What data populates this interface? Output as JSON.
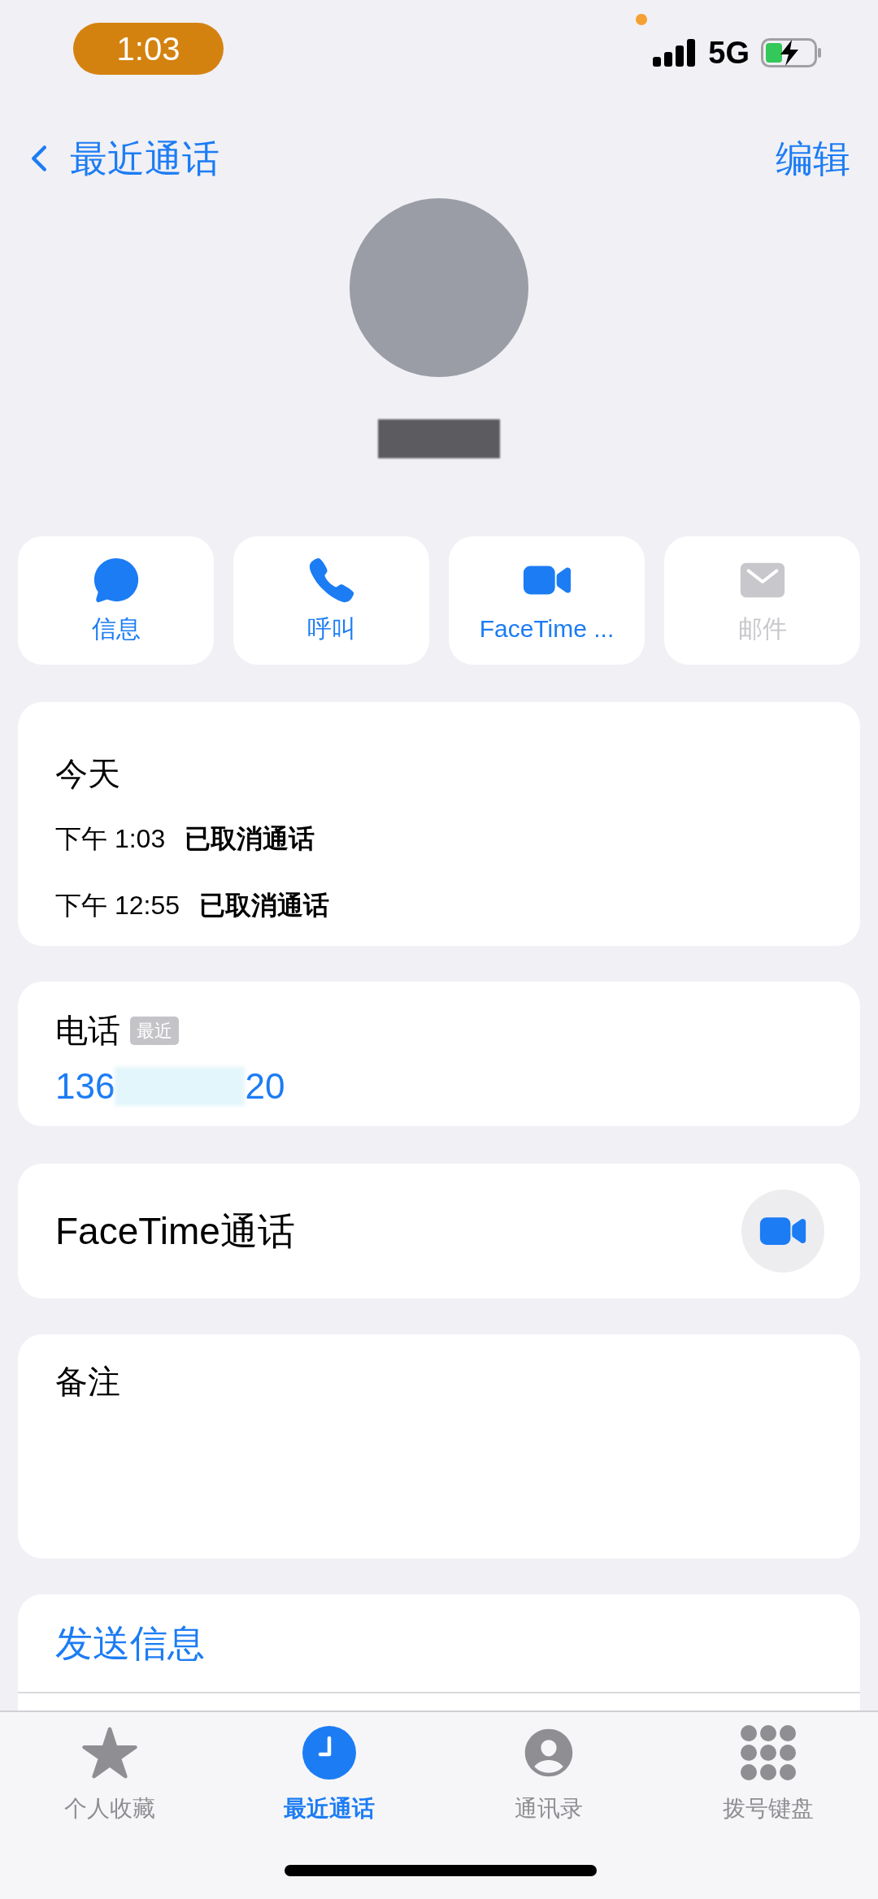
{
  "status_bar": {
    "time": "1:03",
    "network": "5G"
  },
  "nav": {
    "back_label": "最近通话",
    "edit_label": "编辑"
  },
  "actions": [
    {
      "label": "信息",
      "kind": "message",
      "disabled": false
    },
    {
      "label": "呼叫",
      "kind": "call",
      "disabled": false
    },
    {
      "label": "FaceTime ...",
      "kind": "video",
      "disabled": false
    },
    {
      "label": "邮件",
      "kind": "mail",
      "disabled": true
    }
  ],
  "recent_calls": {
    "heading": "今天",
    "calls": [
      {
        "time": "下午 1:03",
        "status": "已取消通话"
      },
      {
        "time": "下午 12:55",
        "status": "已取消通话"
      }
    ]
  },
  "phone": {
    "label": "电话",
    "badge": "最近",
    "number_start": "136",
    "number_end": "20"
  },
  "facetime": {
    "label": "FaceTime通话"
  },
  "notes": {
    "label": "备注"
  },
  "send_message": {
    "label": "发送信息"
  },
  "tab_bar": [
    {
      "label": "个人收藏",
      "kind": "star",
      "selected": false
    },
    {
      "label": "最近通话",
      "kind": "clock",
      "selected": true
    },
    {
      "label": "通讯录",
      "kind": "person",
      "selected": false
    },
    {
      "label": "拨号键盘",
      "kind": "keypad",
      "selected": false
    }
  ]
}
